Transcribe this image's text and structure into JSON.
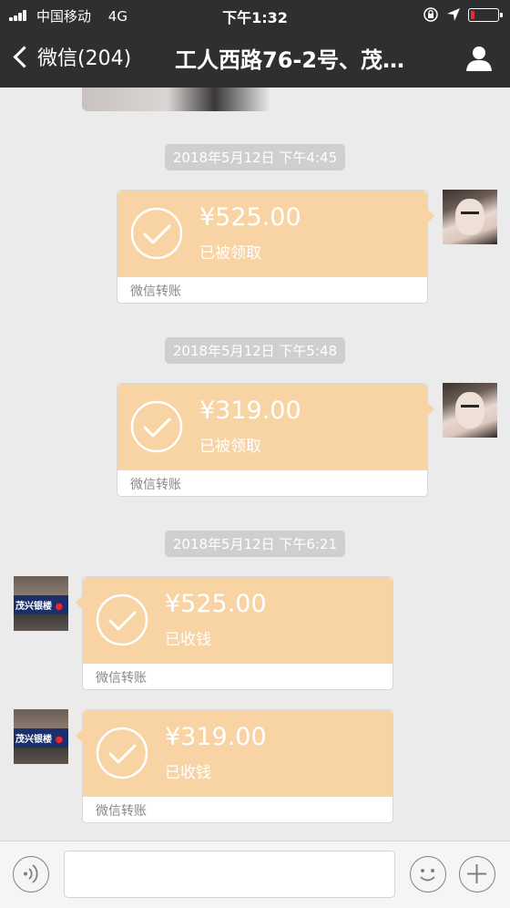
{
  "status_bar": {
    "carrier": "中国移动",
    "network": "4G",
    "time": "下午1:32",
    "battery_level": 0.15,
    "battery_color": "#e3302e"
  },
  "nav": {
    "back_label": "微信(204)",
    "title": "工人西路76-2号、茂…"
  },
  "colors": {
    "header_bg": "#2f2f31",
    "chat_bg": "#ebebeb",
    "transfer_bubble": "#f8d3a3"
  },
  "messages": [
    {
      "timestamp": "2018年5月12日 下午4:45",
      "side": "right",
      "avatar": "woman-photo",
      "amount": "¥525.00",
      "status": "已被领取",
      "footer": "微信转账"
    },
    {
      "timestamp": "2018年5月12日 下午5:48",
      "side": "right",
      "avatar": "woman-photo",
      "amount": "¥319.00",
      "status": "已被领取",
      "footer": "微信转账"
    },
    {
      "timestamp": "2018年5月12日 下午6:21",
      "side": "left",
      "avatar": "storefront-photo",
      "amount": "¥525.00",
      "status": "已收钱",
      "footer": "微信转账"
    },
    {
      "side": "left",
      "avatar": "storefront-photo",
      "amount": "¥319.00",
      "status": "已收钱",
      "footer": "微信转账"
    }
  ],
  "avatar_sign": {
    "text": "茂兴银楼"
  },
  "input_bar": {
    "placeholder": "",
    "icons": [
      "voice-icon",
      "emoji-icon",
      "plus-icon"
    ]
  }
}
